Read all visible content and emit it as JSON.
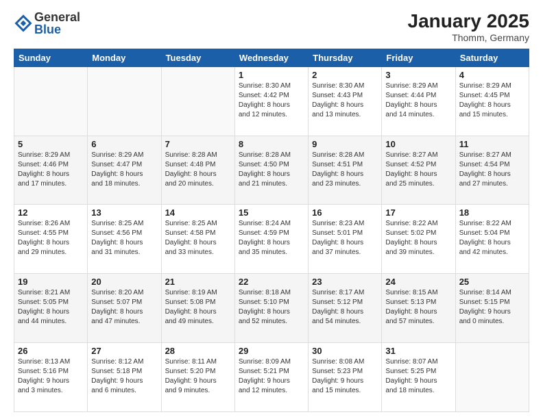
{
  "logo": {
    "general": "General",
    "blue": "Blue"
  },
  "title": "January 2025",
  "subtitle": "Thomm, Germany",
  "weekdays": [
    "Sunday",
    "Monday",
    "Tuesday",
    "Wednesday",
    "Thursday",
    "Friday",
    "Saturday"
  ],
  "weeks": [
    [
      {
        "day": "",
        "info": ""
      },
      {
        "day": "",
        "info": ""
      },
      {
        "day": "",
        "info": ""
      },
      {
        "day": "1",
        "info": "Sunrise: 8:30 AM\nSunset: 4:42 PM\nDaylight: 8 hours\nand 12 minutes."
      },
      {
        "day": "2",
        "info": "Sunrise: 8:30 AM\nSunset: 4:43 PM\nDaylight: 8 hours\nand 13 minutes."
      },
      {
        "day": "3",
        "info": "Sunrise: 8:29 AM\nSunset: 4:44 PM\nDaylight: 8 hours\nand 14 minutes."
      },
      {
        "day": "4",
        "info": "Sunrise: 8:29 AM\nSunset: 4:45 PM\nDaylight: 8 hours\nand 15 minutes."
      }
    ],
    [
      {
        "day": "5",
        "info": "Sunrise: 8:29 AM\nSunset: 4:46 PM\nDaylight: 8 hours\nand 17 minutes."
      },
      {
        "day": "6",
        "info": "Sunrise: 8:29 AM\nSunset: 4:47 PM\nDaylight: 8 hours\nand 18 minutes."
      },
      {
        "day": "7",
        "info": "Sunrise: 8:28 AM\nSunset: 4:48 PM\nDaylight: 8 hours\nand 20 minutes."
      },
      {
        "day": "8",
        "info": "Sunrise: 8:28 AM\nSunset: 4:50 PM\nDaylight: 8 hours\nand 21 minutes."
      },
      {
        "day": "9",
        "info": "Sunrise: 8:28 AM\nSunset: 4:51 PM\nDaylight: 8 hours\nand 23 minutes."
      },
      {
        "day": "10",
        "info": "Sunrise: 8:27 AM\nSunset: 4:52 PM\nDaylight: 8 hours\nand 25 minutes."
      },
      {
        "day": "11",
        "info": "Sunrise: 8:27 AM\nSunset: 4:54 PM\nDaylight: 8 hours\nand 27 minutes."
      }
    ],
    [
      {
        "day": "12",
        "info": "Sunrise: 8:26 AM\nSunset: 4:55 PM\nDaylight: 8 hours\nand 29 minutes."
      },
      {
        "day": "13",
        "info": "Sunrise: 8:25 AM\nSunset: 4:56 PM\nDaylight: 8 hours\nand 31 minutes."
      },
      {
        "day": "14",
        "info": "Sunrise: 8:25 AM\nSunset: 4:58 PM\nDaylight: 8 hours\nand 33 minutes."
      },
      {
        "day": "15",
        "info": "Sunrise: 8:24 AM\nSunset: 4:59 PM\nDaylight: 8 hours\nand 35 minutes."
      },
      {
        "day": "16",
        "info": "Sunrise: 8:23 AM\nSunset: 5:01 PM\nDaylight: 8 hours\nand 37 minutes."
      },
      {
        "day": "17",
        "info": "Sunrise: 8:22 AM\nSunset: 5:02 PM\nDaylight: 8 hours\nand 39 minutes."
      },
      {
        "day": "18",
        "info": "Sunrise: 8:22 AM\nSunset: 5:04 PM\nDaylight: 8 hours\nand 42 minutes."
      }
    ],
    [
      {
        "day": "19",
        "info": "Sunrise: 8:21 AM\nSunset: 5:05 PM\nDaylight: 8 hours\nand 44 minutes."
      },
      {
        "day": "20",
        "info": "Sunrise: 8:20 AM\nSunset: 5:07 PM\nDaylight: 8 hours\nand 47 minutes."
      },
      {
        "day": "21",
        "info": "Sunrise: 8:19 AM\nSunset: 5:08 PM\nDaylight: 8 hours\nand 49 minutes."
      },
      {
        "day": "22",
        "info": "Sunrise: 8:18 AM\nSunset: 5:10 PM\nDaylight: 8 hours\nand 52 minutes."
      },
      {
        "day": "23",
        "info": "Sunrise: 8:17 AM\nSunset: 5:12 PM\nDaylight: 8 hours\nand 54 minutes."
      },
      {
        "day": "24",
        "info": "Sunrise: 8:15 AM\nSunset: 5:13 PM\nDaylight: 8 hours\nand 57 minutes."
      },
      {
        "day": "25",
        "info": "Sunrise: 8:14 AM\nSunset: 5:15 PM\nDaylight: 9 hours\nand 0 minutes."
      }
    ],
    [
      {
        "day": "26",
        "info": "Sunrise: 8:13 AM\nSunset: 5:16 PM\nDaylight: 9 hours\nand 3 minutes."
      },
      {
        "day": "27",
        "info": "Sunrise: 8:12 AM\nSunset: 5:18 PM\nDaylight: 9 hours\nand 6 minutes."
      },
      {
        "day": "28",
        "info": "Sunrise: 8:11 AM\nSunset: 5:20 PM\nDaylight: 9 hours\nand 9 minutes."
      },
      {
        "day": "29",
        "info": "Sunrise: 8:09 AM\nSunset: 5:21 PM\nDaylight: 9 hours\nand 12 minutes."
      },
      {
        "day": "30",
        "info": "Sunrise: 8:08 AM\nSunset: 5:23 PM\nDaylight: 9 hours\nand 15 minutes."
      },
      {
        "day": "31",
        "info": "Sunrise: 8:07 AM\nSunset: 5:25 PM\nDaylight: 9 hours\nand 18 minutes."
      },
      {
        "day": "",
        "info": ""
      }
    ]
  ]
}
